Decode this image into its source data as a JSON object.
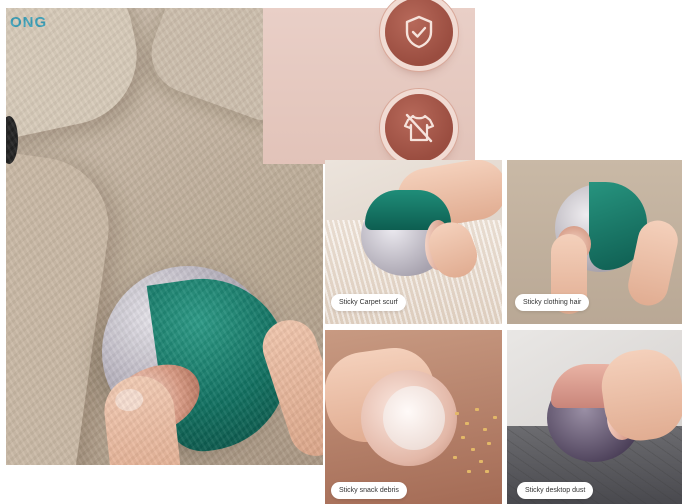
{
  "brand": "ONG",
  "hero": {
    "image": "lint-roller-ball-on-beige-coat"
  },
  "features": [
    {
      "icon": "shield-check-icon"
    },
    {
      "icon": "shirt-crossed-icon"
    }
  ],
  "tiles": [
    {
      "label": "Sticky Carpet scurf"
    },
    {
      "label": "Sticky clothing hair"
    },
    {
      "label": "Sticky snack debris"
    },
    {
      "label": "Sticky desktop dust"
    }
  ],
  "colors": {
    "shell_green": "#117060",
    "rose_gold": "#d99b84",
    "pink_panel": "#e9cfc7",
    "icon_circle": "#9a4d40",
    "brand_blue": "#3a9fb8"
  }
}
